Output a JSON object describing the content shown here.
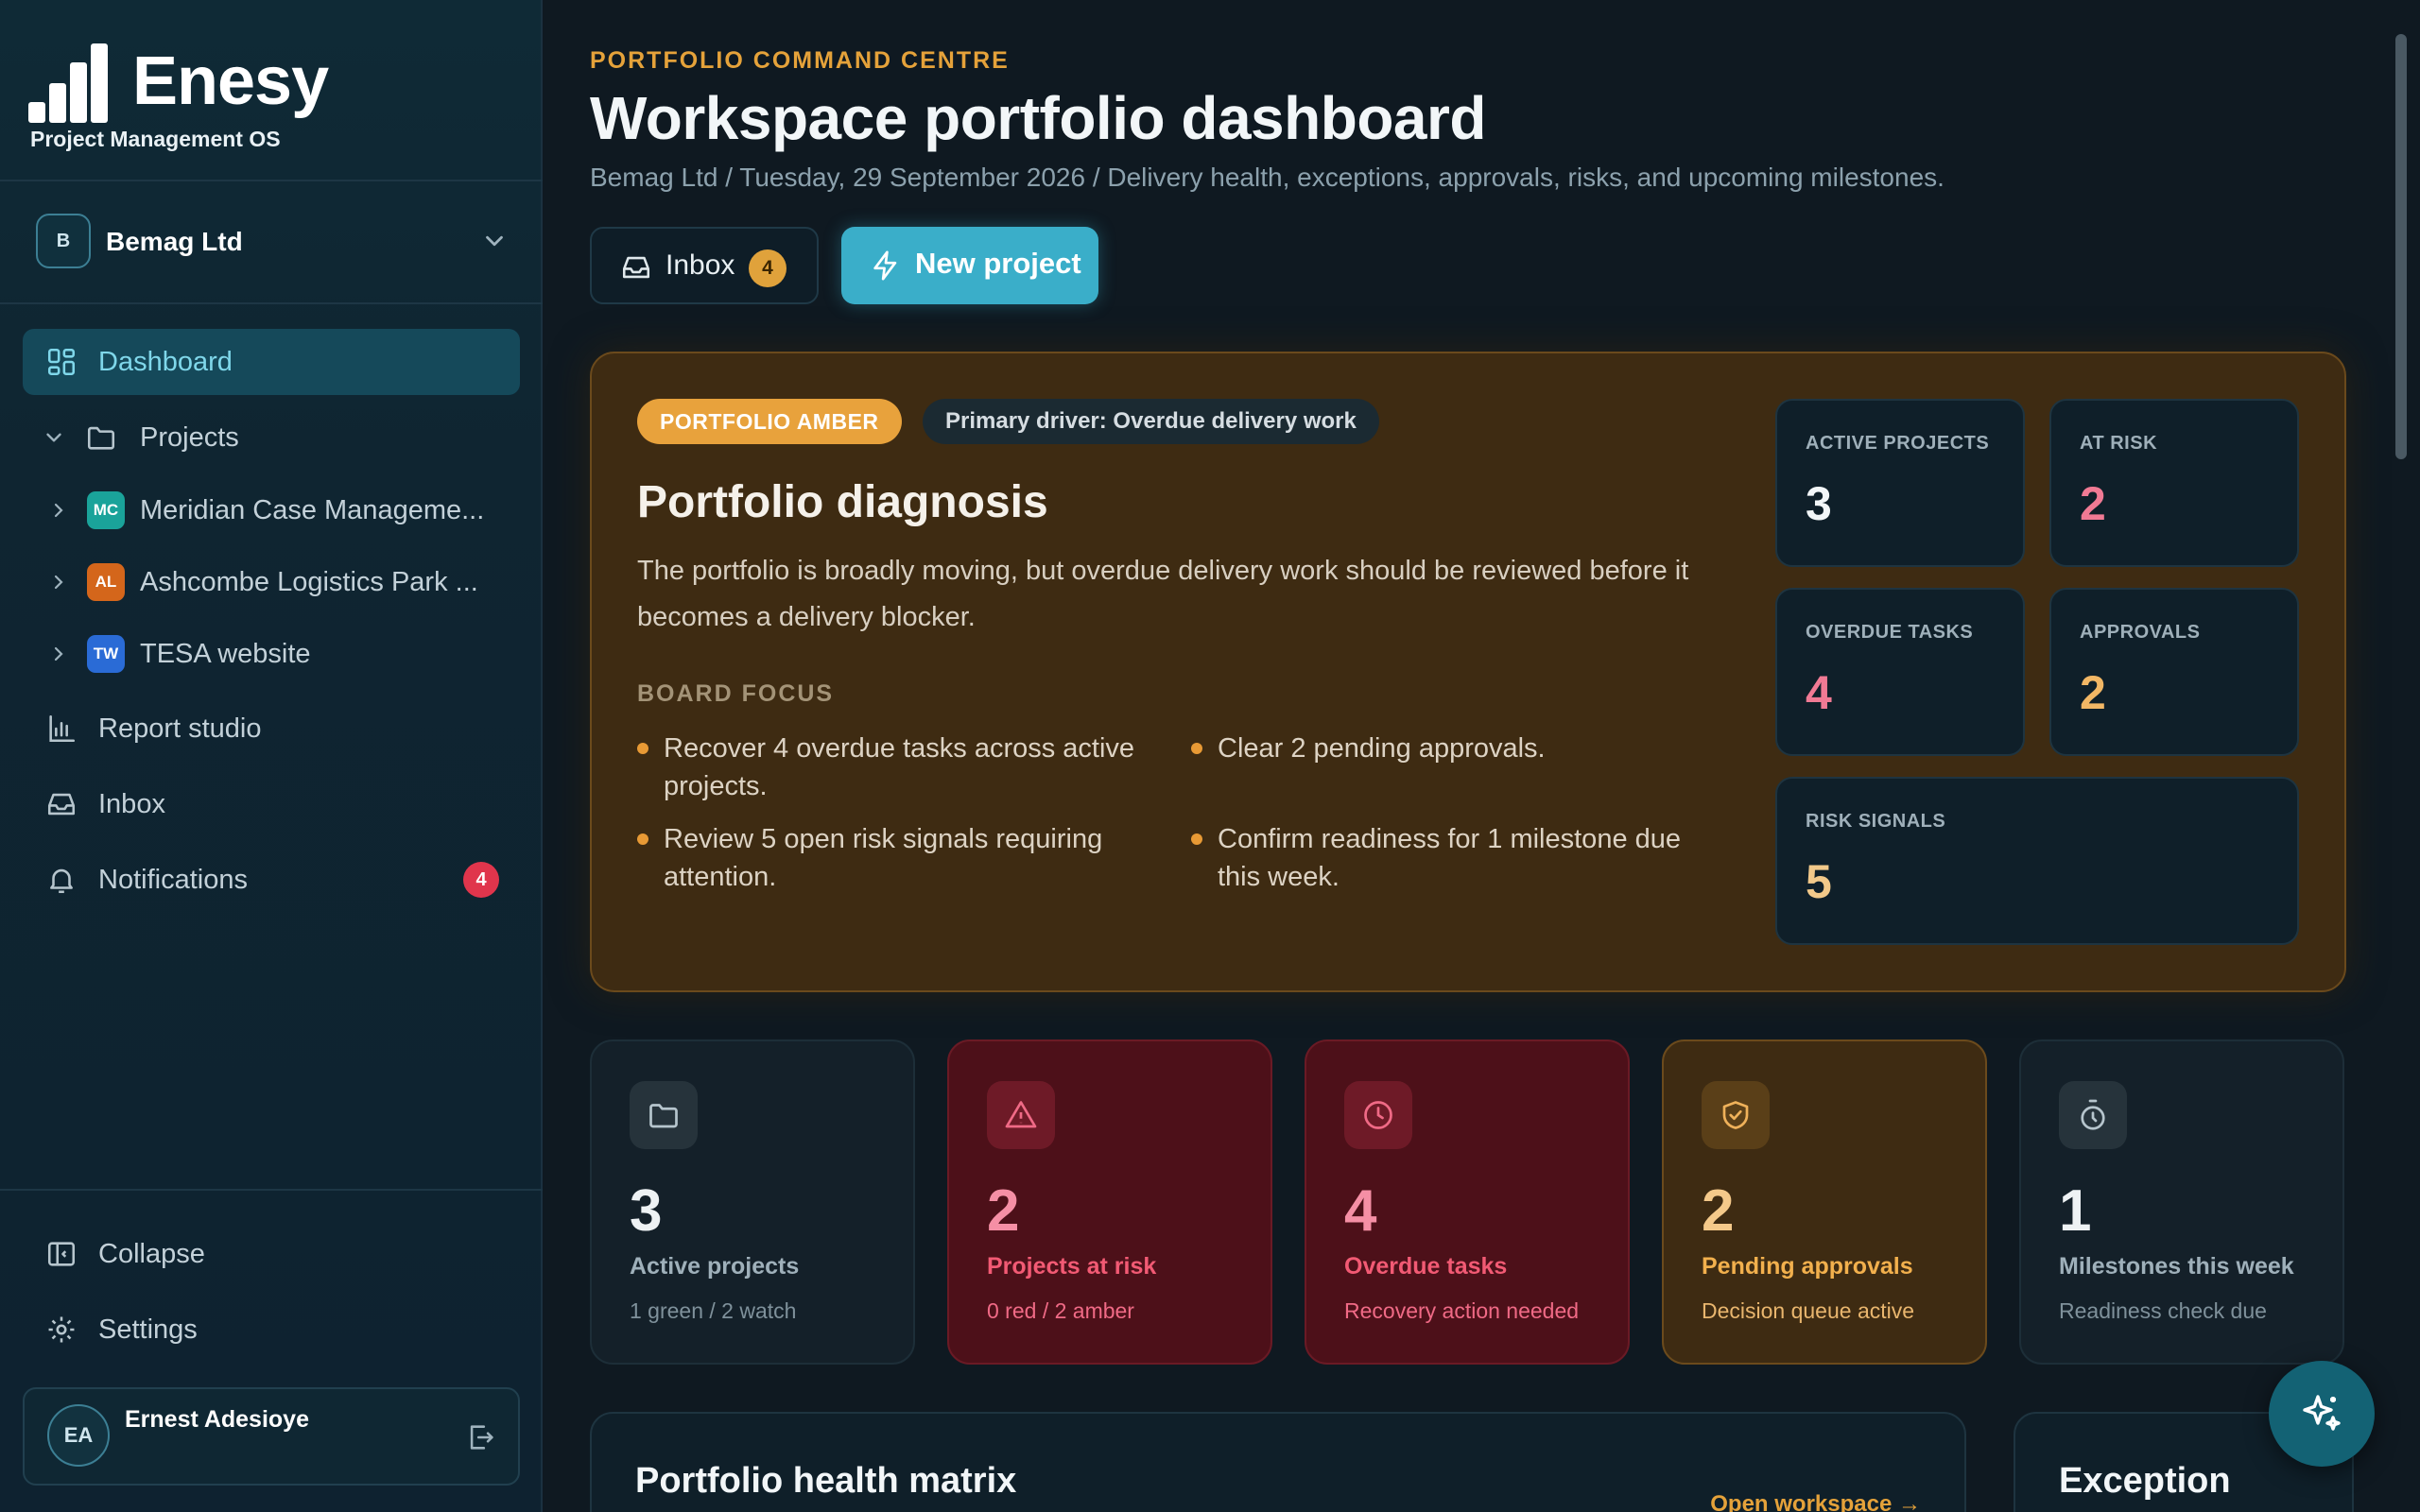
{
  "brand": {
    "name": "Enesy",
    "tagline": "Project Management OS"
  },
  "org": {
    "initial": "B",
    "name": "Bemag Ltd"
  },
  "nav": {
    "dashboard": "Dashboard",
    "projects": "Projects",
    "project_items": [
      {
        "initials": "MC",
        "label": "Meridian Case Manageme...",
        "color": "#1aa39a"
      },
      {
        "initials": "AL",
        "label": "Ashcombe Logistics Park ...",
        "color": "#d4661b"
      },
      {
        "initials": "TW",
        "label": "TESA website",
        "color": "#2a6bd6"
      }
    ],
    "report_studio": "Report studio",
    "inbox": "Inbox",
    "notifications": "Notifications",
    "notifications_count": "4",
    "collapse": "Collapse",
    "settings": "Settings"
  },
  "user": {
    "initials": "EA",
    "name": "Ernest Adesioye"
  },
  "header": {
    "eyebrow": "PORTFOLIO COMMAND CENTRE",
    "title": "Workspace portfolio dashboard",
    "subtitle": "Bemag Ltd / Tuesday, 29 September 2026 / Delivery health, exceptions, approvals, risks, and upcoming milestones.",
    "inbox_label": "Inbox",
    "inbox_count": "4",
    "new_project_label": "New project"
  },
  "diagnosis": {
    "status_pill": "PORTFOLIO AMBER",
    "driver_pill": "Primary driver: Overdue delivery work",
    "title": "Portfolio diagnosis",
    "text": "The portfolio is broadly moving, but overdue delivery work should be reviewed before it becomes a delivery blocker.",
    "board_focus_label": "BOARD FOCUS",
    "focus_items": [
      "Recover 4 overdue tasks across active projects.",
      "Clear 2 pending approvals.",
      "Review 5 open risk signals requiring attention.",
      "Confirm readiness for 1 milestone due this week."
    ],
    "stats": [
      {
        "label": "ACTIVE PROJECTS",
        "value": "3",
        "color": "#f2f6f8"
      },
      {
        "label": "AT RISK",
        "value": "2",
        "color": "#f07a94"
      },
      {
        "label": "OVERDUE TASKS",
        "value": "4",
        "color": "#f07a94"
      },
      {
        "label": "APPROVALS",
        "value": "2",
        "color": "#f2b765"
      },
      {
        "label": "RISK SIGNALS",
        "value": "5",
        "color": "#f2c98a"
      }
    ]
  },
  "kpis": [
    {
      "icon": "folder-icon",
      "value": "3",
      "label": "Active projects",
      "sub": "1 green / 2 watch"
    },
    {
      "icon": "warning-icon",
      "value": "2",
      "label": "Projects at risk",
      "sub": "0 red / 2 amber"
    },
    {
      "icon": "clock-icon",
      "value": "4",
      "label": "Overdue tasks",
      "sub": "Recovery action needed"
    },
    {
      "icon": "shield-check-icon",
      "value": "2",
      "label": "Pending approvals",
      "sub": "Decision queue active"
    },
    {
      "icon": "timer-icon",
      "value": "1",
      "label": "Milestones this week",
      "sub": "Readiness check due"
    }
  ],
  "panels": {
    "health_title": "Portfolio health matrix",
    "health_link": "Open workspace →",
    "exception_title": "Exception"
  }
}
